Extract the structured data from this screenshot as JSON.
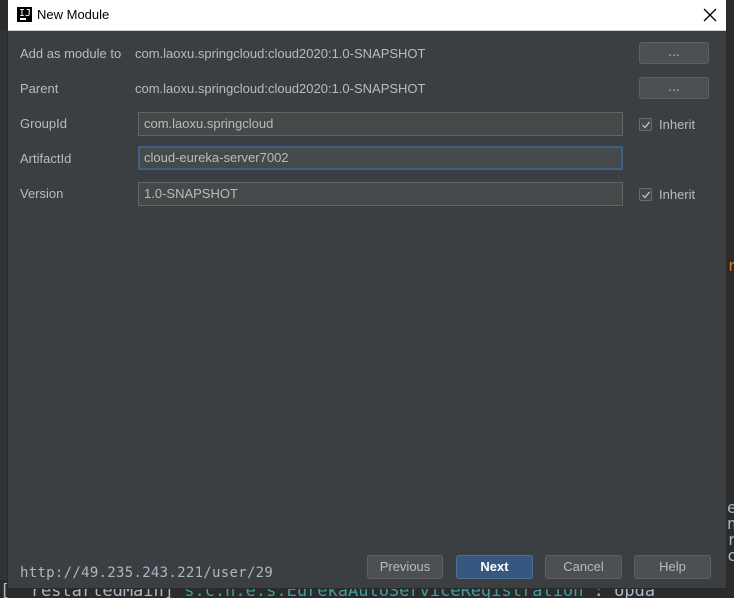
{
  "dialog": {
    "title": "New Module",
    "rows": {
      "add_as_module_to": {
        "label": "Add as module to",
        "value": "com.laoxu.springcloud:cloud2020:1.0-SNAPSHOT",
        "button": "..."
      },
      "parent": {
        "label": "Parent",
        "value": "com.laoxu.springcloud:cloud2020:1.0-SNAPSHOT",
        "button": "..."
      },
      "group_id": {
        "label": "GroupId",
        "value": "com.laoxu.springcloud",
        "inherit_label": "Inherit",
        "inherit_checked": true
      },
      "artifact_id": {
        "label": "ArtifactId",
        "value": "cloud-eureka-server7002"
      },
      "version": {
        "label": "Version",
        "value": "1.0-SNAPSHOT",
        "inherit_label": "Inherit",
        "inherit_checked": true
      }
    },
    "status_url": "http://49.235.243.221/user/29",
    "buttons": {
      "previous": "Previous",
      "next": "Next",
      "cancel": "Cancel",
      "help": "Help"
    }
  },
  "background": {
    "console_line": {
      "prefix": "[  restartedMain] ",
      "logger": "s.c.n.e.s.EurekaAutoServiceRegistration",
      "suffix": " : Upda"
    }
  },
  "colors": {
    "dialog_bg": "#3c3f41",
    "field_bg": "#45494a",
    "primary_button": "#365880",
    "focus_border": "#3d6185"
  }
}
